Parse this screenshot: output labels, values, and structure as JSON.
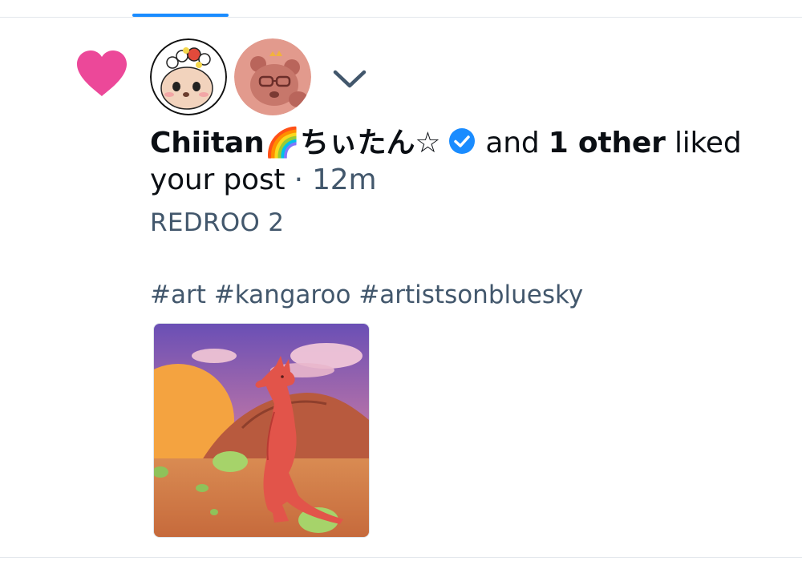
{
  "notification": {
    "type_icon": "heart-icon",
    "liker_name": "Chiitan🌈ちぃたん☆",
    "verified_icon": "verified-check-icon",
    "and_text": "and",
    "others_text": "1 other",
    "liked_text": "liked your post",
    "separator": "·",
    "time": "12m",
    "expand_icon": "chevron-down-icon"
  },
  "post": {
    "title": "REDROO 2",
    "tags": "#art #kangaroo #artistsonbluesky"
  },
  "colors": {
    "heart": "#ec4899",
    "accent": "#1a8cff",
    "text": "#0b0f14",
    "muted": "#42576c"
  }
}
